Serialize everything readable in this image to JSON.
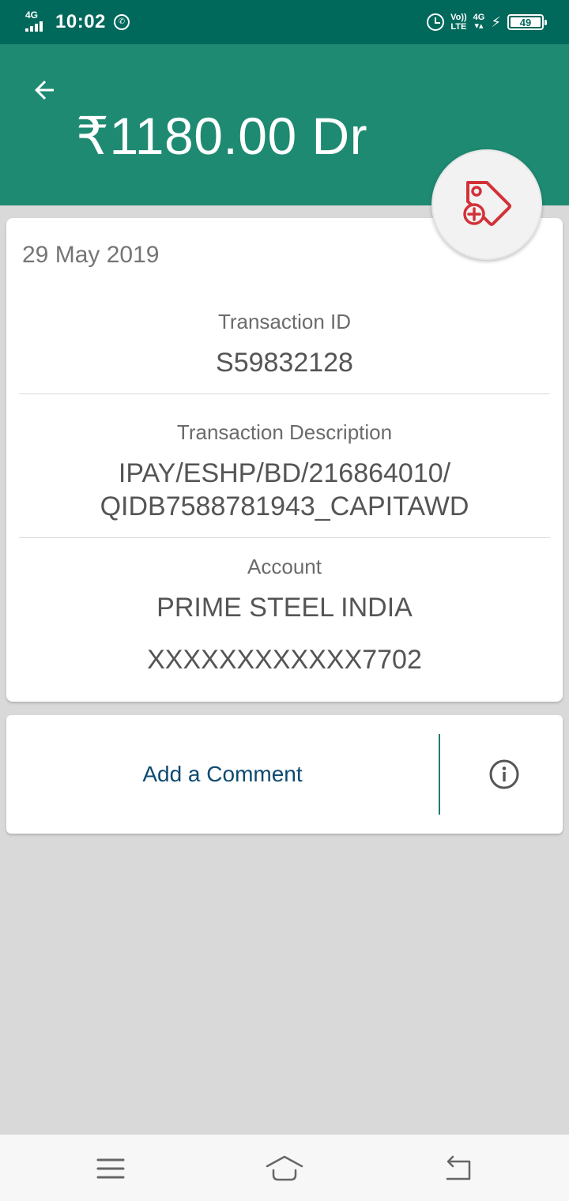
{
  "status_bar": {
    "network_left": "4G",
    "time": "10:02",
    "volte": "Vo)) LTE",
    "network_right": "4G",
    "battery_level": "49",
    "battery_fraction": 0.49
  },
  "header": {
    "amount": "₹1180.00 Dr",
    "back_icon": "arrow-left-icon",
    "tag_icon": "tag-add-icon",
    "bg_color": "#1e8a72"
  },
  "details": {
    "date": "29 May 2019",
    "transaction_id_label": "Transaction ID",
    "transaction_id_value": "S59832128",
    "description_label": "Transaction Description",
    "description_line1": "IPAY/ESHP/BD/216864010/",
    "description_line2": "QIDB7588781943_CAPITAWD",
    "account_label": "Account",
    "account_name": "PRIME STEEL INDIA",
    "account_number": "XXXXXXXXXXXX7702"
  },
  "comment": {
    "add_label": "Add a Comment",
    "info_icon": "info-icon"
  },
  "nav": {
    "menu_icon": "menu-icon",
    "home_icon": "home-icon",
    "back_icon": "back-nav-icon"
  },
  "colors": {
    "status_bar": "#00695c",
    "header": "#1e8a72",
    "accent_red": "#d23238",
    "link_blue": "#0d4a70"
  }
}
